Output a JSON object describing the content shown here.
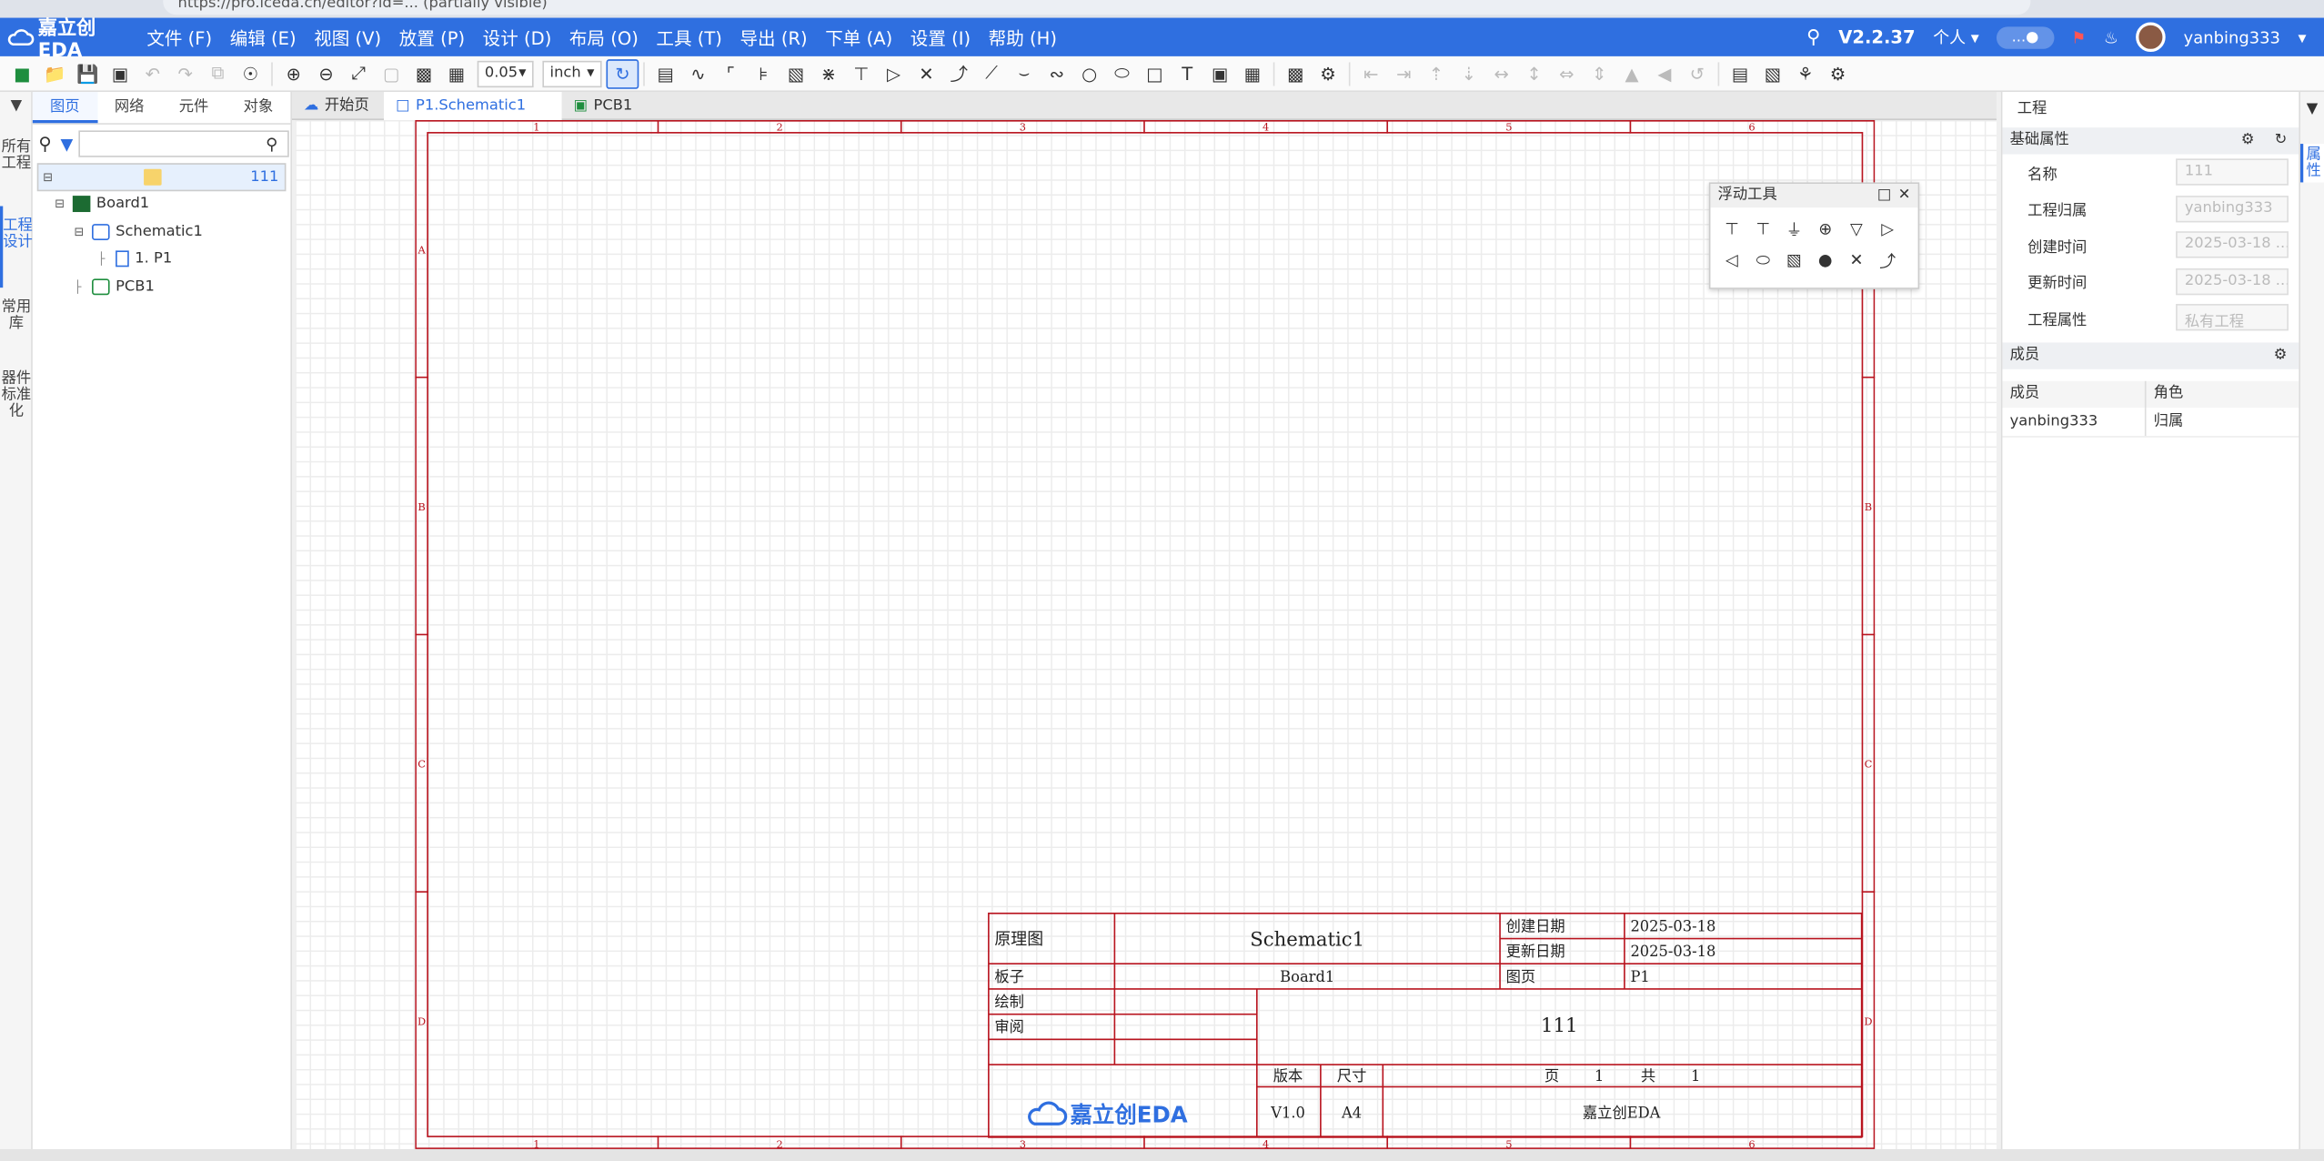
{
  "browser": {
    "url": "https://pro.lceda.cn/editor?id=...  (partially visible)"
  },
  "app": {
    "logo_text": "嘉立创EDA",
    "version": "V2.2.37",
    "account_mode": "个人",
    "user": "yanbing333",
    "pill": "...●"
  },
  "menu": [
    "文件 (F)",
    "编辑 (E)",
    "视图 (V)",
    "放置 (P)",
    "设计 (D)",
    "布局 (O)",
    "工具 (T)",
    "导出 (R)",
    "下单 (A)",
    "设置 (I)",
    "帮助 (H)"
  ],
  "toolbar": {
    "grid_value": "0.05",
    "unit": "inch"
  },
  "vstrip": [
    "所有工程",
    "工程设计",
    "常用库",
    "器件标准化"
  ],
  "left_tabs": [
    "图页",
    "网络",
    "元件",
    "对象"
  ],
  "tree": {
    "root": "111",
    "board": "Board1",
    "schematic": "Schematic1",
    "page": "1. P1",
    "pcb": "PCB1"
  },
  "doc_tabs": [
    "开始页",
    "P1.Schematic1",
    "PCB1"
  ],
  "frame": {
    "cols": [
      "1",
      "2",
      "3",
      "4",
      "5",
      "6"
    ],
    "rows": [
      "A",
      "B",
      "C",
      "D"
    ]
  },
  "title_block": {
    "label_schematic": "原理图",
    "schematic_name": "Schematic1",
    "label_created": "创建日期",
    "created": "2025-03-18",
    "label_updated": "更新日期",
    "updated": "2025-03-18",
    "label_board": "板子",
    "board": "Board1",
    "label_page": "图页",
    "page": "P1",
    "label_draw": "绘制",
    "label_review": "审阅",
    "project": "111",
    "label_version": "版本",
    "label_size": "尺寸",
    "version": "V1.0",
    "size": "A4",
    "page_label": "页",
    "page_num": "1",
    "total_label": "共",
    "total_num": "1",
    "company": "嘉立创EDA",
    "logo_text": "嘉立创EDA"
  },
  "float_tools": {
    "title": "浮动工具"
  },
  "right_panel": {
    "title": "工程",
    "section_basic": "基础属性",
    "props": [
      {
        "label": "名称",
        "value": "111"
      },
      {
        "label": "工程归属",
        "value": "yanbing333"
      },
      {
        "label": "创建时间",
        "value": "2025-03-18 ..."
      },
      {
        "label": "更新时间",
        "value": "2025-03-18 ..."
      },
      {
        "label": "工程属性",
        "value": "私有工程"
      }
    ],
    "section_members": "成员",
    "member_cols": [
      "成员",
      "角色"
    ],
    "members": [
      {
        "name": "yanbing333",
        "role": "归属"
      }
    ],
    "side_tab": "属性"
  },
  "colors": {
    "menubar": "#2f6fe0",
    "frame": "#b8141f",
    "accent": "#2f6fe0"
  }
}
